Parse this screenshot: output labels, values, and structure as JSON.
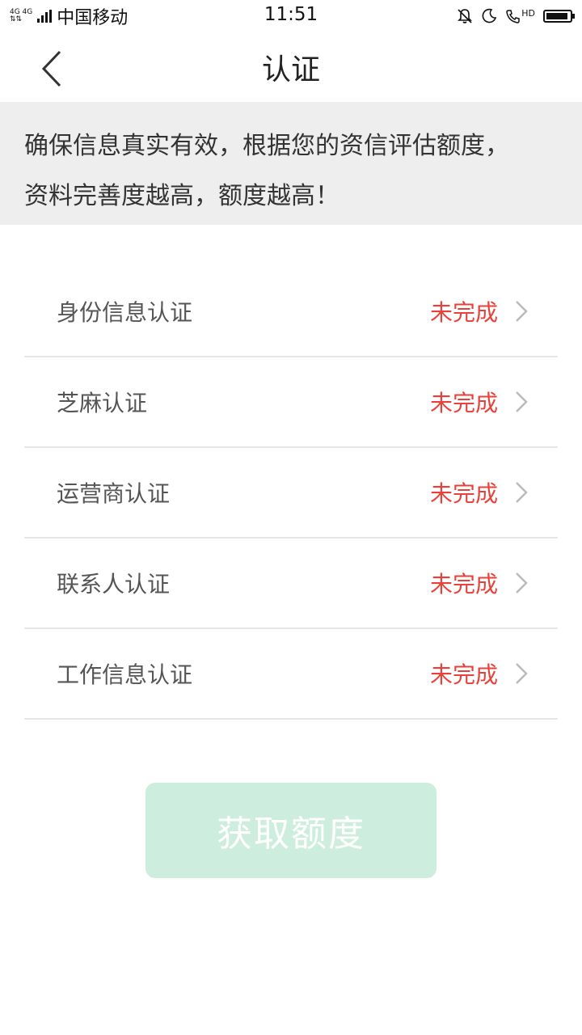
{
  "status_bar": {
    "network_top": "4G 4G",
    "carrier": "中国移动",
    "time": "11:51",
    "hd_label": "HD",
    "icons": [
      "mute-bell-icon",
      "moon-icon",
      "phone-hd-icon",
      "battery-icon"
    ]
  },
  "nav": {
    "title": "认证",
    "back_icon": "chevron-left-icon"
  },
  "notice": {
    "line1": "确保信息真实有效，根据您的资信评估额度，",
    "line2": "资料完善度越高，额度越高！"
  },
  "items": [
    {
      "label": "身份信息认证",
      "status": "未完成"
    },
    {
      "label": "芝麻认证",
      "status": "未完成"
    },
    {
      "label": "运营商认证",
      "status": "未完成"
    },
    {
      "label": "联系人认证",
      "status": "未完成"
    },
    {
      "label": "工作信息认证",
      "status": "未完成"
    }
  ],
  "submit_label": "获取额度",
  "colors": {
    "status_red": "#e8413a",
    "button_bg": "#cdeedf",
    "notice_bg": "#eeeeee"
  }
}
